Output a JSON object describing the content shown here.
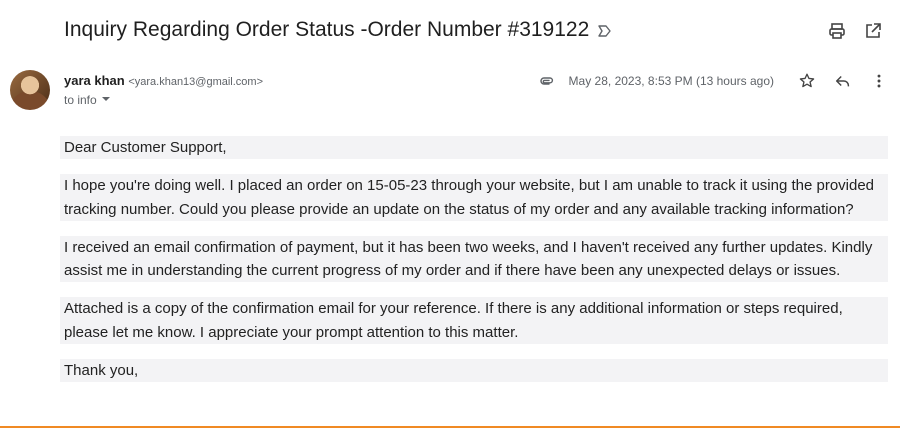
{
  "email": {
    "subject": "Inquiry Regarding Order Status -Order Number #319122",
    "sender": {
      "name": "yara khan",
      "email": "<yara.khan13@gmail.com>",
      "to_label": "to info"
    },
    "date": "May 28, 2023, 8:53 PM (13 hours ago)",
    "body": {
      "greeting": "Dear Customer Support,",
      "paragraph_1": "I hope you're doing well. I placed an order on 15-05-23 through your website, but I am unable to track it using the provided tracking number. Could you please provide an update on the status of my order and any available tracking information?",
      "paragraph_2": "I received an email confirmation of payment, but it has been two weeks, and I haven't received any further updates. Kindly assist me in understanding the current progress of my order and if there have been any unexpected delays or issues.",
      "paragraph_3": "Attached is a copy of the confirmation email for your reference. If there is any additional information or steps required, please let me know. I appreciate your prompt attention to this matter.",
      "closing": "Thank you,"
    }
  },
  "icons": {
    "label": "label-icon",
    "print": "print-icon",
    "open_new": "open-in-new-icon",
    "attachment": "attachment-icon",
    "star": "star-icon",
    "reply": "reply-icon",
    "more": "more-vertical-icon",
    "dropdown": "chevron-down-icon"
  },
  "colors": {
    "accent_bottom": "#f08a24",
    "body_highlight": "#f3f3f5",
    "muted_text": "#5f6368"
  }
}
